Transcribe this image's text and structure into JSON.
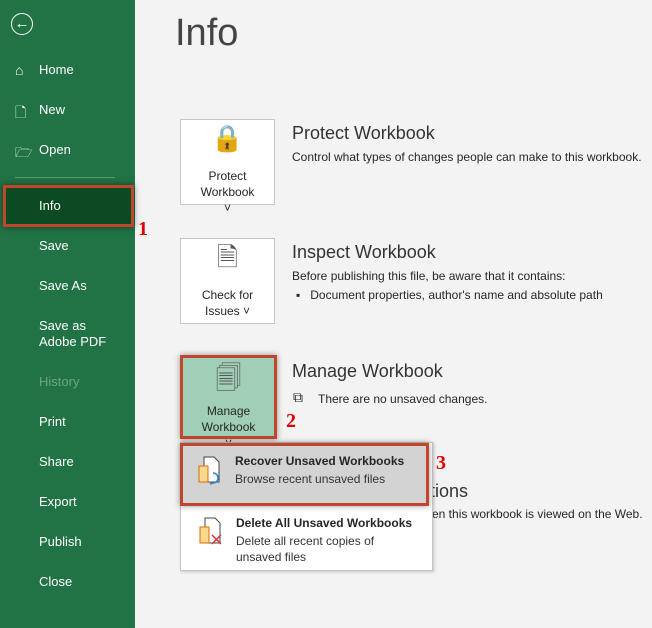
{
  "sidebar": {
    "items": [
      {
        "label": "Home",
        "icon": "home-icon"
      },
      {
        "label": "New",
        "icon": "new-doc-icon"
      },
      {
        "label": "Open",
        "icon": "folder-icon"
      },
      {
        "label": "Info"
      },
      {
        "label": "Save"
      },
      {
        "label": "Save As"
      },
      {
        "label": "Save as Adobe PDF"
      },
      {
        "label": "History"
      },
      {
        "label": "Print"
      },
      {
        "label": "Share"
      },
      {
        "label": "Export"
      },
      {
        "label": "Publish"
      },
      {
        "label": "Close"
      }
    ]
  },
  "page_title": "Info",
  "protect": {
    "button": "Protect Workbook",
    "title": "Protect Workbook",
    "desc": "Control what types of changes people can make to this workbook."
  },
  "inspect": {
    "button": "Check for Issues",
    "title": "Inspect Workbook",
    "desc": "Before publishing this file, be aware that it contains:",
    "bullet": "Document properties, author's name and absolute path"
  },
  "manage": {
    "button": "Manage Workbook",
    "title": "Manage Workbook",
    "desc": "There are no unsaved changes."
  },
  "behind": {
    "title_fragment": "tions",
    "desc_fragment": "en this workbook is viewed on the Web."
  },
  "menu": {
    "recover": {
      "title": "Recover Unsaved Workbooks",
      "desc": "Browse recent unsaved files"
    },
    "delete": {
      "title": "Delete All Unsaved Workbooks",
      "desc": "Delete all recent copies of unsaved files"
    }
  },
  "annotations": [
    "1",
    "2",
    "3"
  ],
  "colors": {
    "sidebar": "#217346",
    "selected": "#0b4a22",
    "highlight": "#c0462e"
  }
}
